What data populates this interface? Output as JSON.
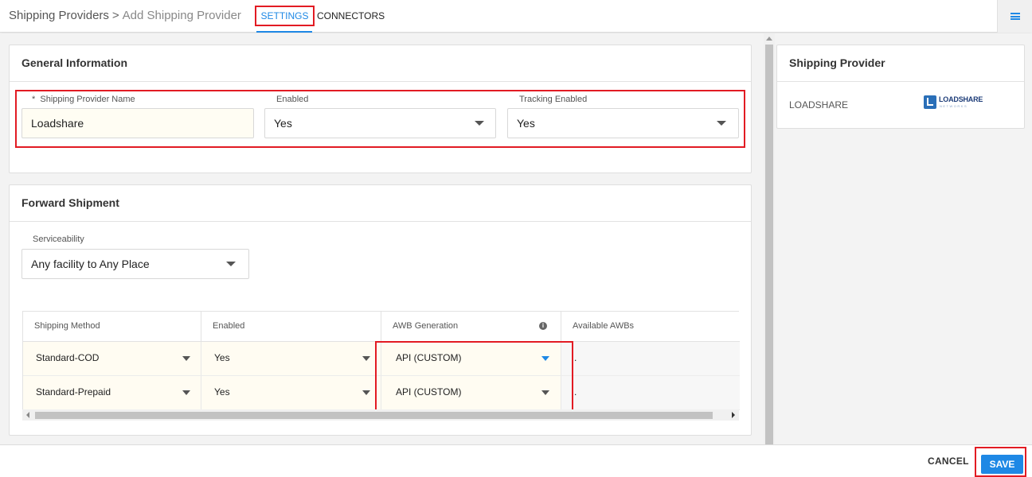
{
  "header": {
    "breadcrumb_parent": "Shipping Providers",
    "breadcrumb_separator": ">",
    "breadcrumb_current": "Add Shipping Provider",
    "tabs": [
      {
        "label": "SETTINGS",
        "active": true
      },
      {
        "label": "CONNECTORS",
        "active": false
      }
    ],
    "menu_icon": "hamburger-menu-icon"
  },
  "general": {
    "title": "General Information",
    "name_required_mark": "*",
    "name_label": "Shipping Provider Name",
    "name_value": "Loadshare",
    "enabled_label": "Enabled",
    "enabled_value": "Yes",
    "tracking_label": "Tracking Enabled",
    "tracking_value": "Yes"
  },
  "forward": {
    "title": "Forward Shipment",
    "serviceability_label": "Serviceability",
    "serviceability_value": "Any facility to Any Place",
    "columns": [
      "Shipping Method",
      "Enabled",
      "AWB Generation",
      "Available AWBs"
    ],
    "rows": [
      {
        "method": "Standard-COD",
        "enabled": "Yes",
        "awb": "API (CUSTOM)",
        "available": "."
      },
      {
        "method": "Standard-Prepaid",
        "enabled": "Yes",
        "awb": "API (CUSTOM)",
        "available": "."
      }
    ]
  },
  "side": {
    "title": "Shipping Provider",
    "provider_name": "LOADSHARE",
    "logo_text": "LOADSHARE",
    "logo_subtext": "NETWORKS"
  },
  "footer": {
    "cancel_label": "CANCEL",
    "save_label": "SAVE"
  },
  "colors": {
    "accent": "#1e88e5",
    "highlight": "#e21b23",
    "field_bg": "#fffdf3"
  }
}
